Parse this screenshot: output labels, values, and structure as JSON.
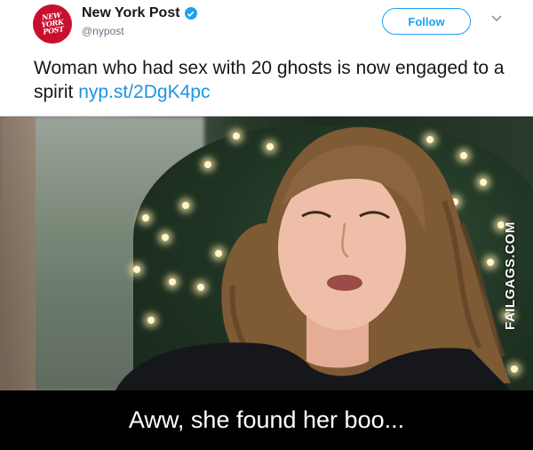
{
  "tweet": {
    "avatar_text": "NEW\nYORK\nPOST",
    "display_name": "New York Post",
    "handle": "@nypost",
    "follow_label": "Follow",
    "text": "Woman who had sex with 20 ghosts is now engaged to a spirit ",
    "link": "nyp.st/2DgK4pc",
    "colors": {
      "brand": "#c8102e",
      "accent": "#1da1f2",
      "link": "#1b95e0"
    }
  },
  "photo": {
    "watermark": "FAILGAGS.COM"
  },
  "caption": "Aww, she found her boo..."
}
